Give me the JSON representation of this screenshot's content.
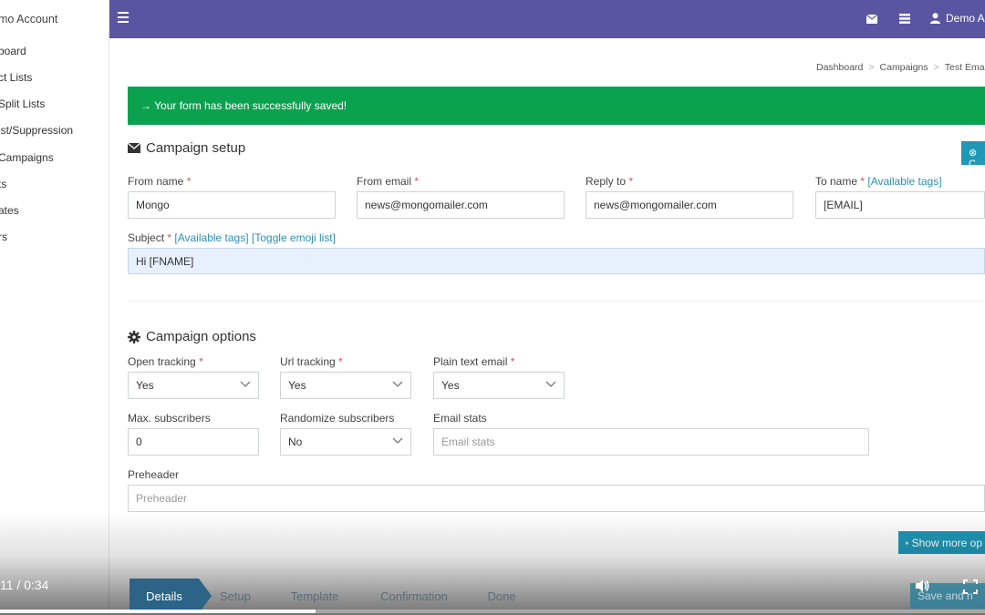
{
  "sidebar": {
    "account": "mo Account",
    "items": [
      {
        "label": "board"
      },
      {
        "label": "ct Lists"
      },
      {
        "label": "Split Lists"
      },
      {
        "label": "ist/Suppression"
      },
      {
        "label": "Campaigns"
      },
      {
        "label": "ts"
      },
      {
        "label": "ates"
      },
      {
        "label": "rs"
      }
    ]
  },
  "topbar": {
    "user": "Demo A",
    "icons": [
      "menu-icon",
      "envelope-icon",
      "list-icon",
      "user-icon"
    ]
  },
  "breadcrumb": [
    "Dashboard",
    "Campaigns",
    "Test Email"
  ],
  "alert": {
    "text": "→ Your form has been successfully saved!"
  },
  "setup": {
    "title": "Campaign setup",
    "close_label": "⊗ C",
    "from_name": {
      "label": "From name",
      "value": "Mongo"
    },
    "from_email": {
      "label": "From email",
      "value": "news@mongomailer.com"
    },
    "reply_to": {
      "label": "Reply to",
      "value": "news@mongomailer.com"
    },
    "to_name": {
      "label": "To name",
      "tags": "[Available tags]",
      "value": "[EMAIL]"
    },
    "subject": {
      "label": "Subject",
      "tags": "[Available tags]",
      "emoji": "[Toggle emoji list]",
      "value": "Hi [FNAME]"
    },
    "required_mark": "*"
  },
  "options": {
    "title": "Campaign options",
    "open_tracking": {
      "label": "Open tracking",
      "value": "Yes"
    },
    "url_tracking": {
      "label": "Url tracking",
      "value": "Yes"
    },
    "plain_text": {
      "label": "Plain text email",
      "value": "Yes"
    },
    "max_subscribers": {
      "label": "Max. subscribers",
      "value": "0"
    },
    "randomize": {
      "label": "Randomize subscribers",
      "value": "No"
    },
    "email_stats": {
      "label": "Email stats",
      "placeholder": "Email stats"
    },
    "preheader": {
      "label": "Preheader",
      "placeholder": "Preheader"
    },
    "show_more_label": "Show more op"
  },
  "steps": [
    {
      "label": "Details",
      "active": true
    },
    {
      "label": "Setup",
      "active": false
    },
    {
      "label": "Template",
      "active": false
    },
    {
      "label": "Confirmation",
      "active": false
    },
    {
      "label": "Done",
      "active": false
    }
  ],
  "save_label": "Save and n",
  "video": {
    "time": "11 / 0:34",
    "progress_percent": 32
  },
  "colors": {
    "topbar": "#5b55a1",
    "alert": "#0aa24f",
    "accent": "#1f97b5",
    "required": "#d9534f",
    "step_active": "#2b6486"
  }
}
